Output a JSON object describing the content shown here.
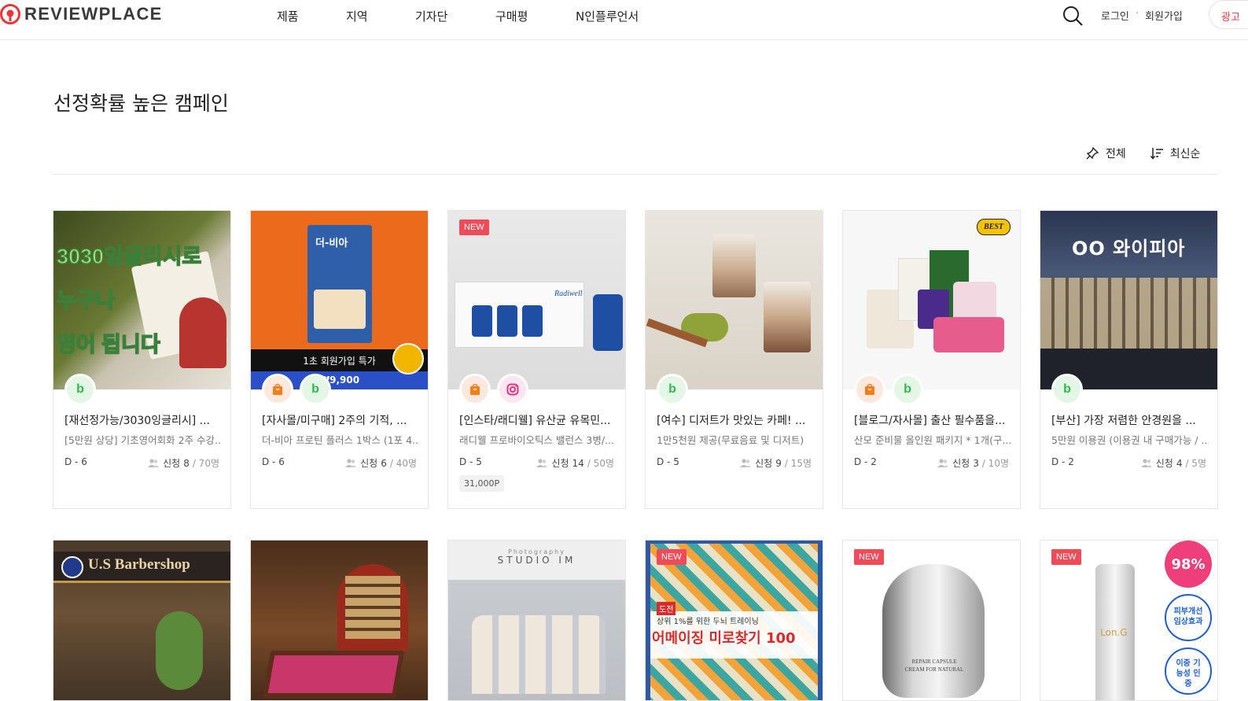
{
  "header": {
    "logo_text": "REVIEWPLACE",
    "nav": [
      "제품",
      "지역",
      "기자단",
      "구매평",
      "N인플루언서"
    ],
    "login": "로그인",
    "separator": "·",
    "signup": "회원가입",
    "ad": "광고"
  },
  "section": {
    "title": "선정확률 높은 캠페인",
    "filter_all": "전체",
    "sort_latest": "최신순"
  },
  "colors": {
    "accent": "#e8363c",
    "new_badge": "#ef4b58",
    "blog_green": "#2fb94a"
  },
  "cards": [
    {
      "title": "[재선정가능/3030잉글리시] ...",
      "subtitle": "[5만원 상당] 기초영어회화 2주 수강...",
      "dday": "D - 6",
      "apply_label": "신청",
      "applied": "8",
      "total": "/ 70명",
      "image_text": [
        "3030잉글리시로",
        "누구나",
        "영어 됩니다"
      ],
      "icons": [
        "blog"
      ]
    },
    {
      "title": "[자사몰/미구매] 2주의 기적, ...",
      "subtitle": "더-비아 프로틴 플러스 1박스 (1포 4...",
      "dday": "D - 6",
      "apply_label": "신청",
      "applied": "6",
      "total": "/ 40명",
      "image_text": [
        "더-비아",
        "1초 회원가입 특가",
        "₩9,900"
      ],
      "icons": [
        "shop",
        "blog"
      ]
    },
    {
      "title": "[인스타/래디웰] 유산균 유목민...",
      "subtitle": "래디웰 프로바이오틱스 밸런스 3병/...",
      "dday": "D - 5",
      "apply_label": "신청",
      "applied": "14",
      "total": "/ 50명",
      "point": "31,000P",
      "badge": "NEW",
      "image_text": [
        "Radiwell"
      ],
      "icons": [
        "shop",
        "insta"
      ]
    },
    {
      "title": "[여수] 디저트가 맛있는 카페! ...",
      "subtitle": "1만5천원 제공(무료음료 및 디저트)",
      "dday": "D - 5",
      "apply_label": "신청",
      "applied": "9",
      "total": "/ 15명",
      "icons": [
        "blog"
      ]
    },
    {
      "title": "[블로그/자사몰] 출산 필수품을...",
      "subtitle": "산모 준비물 올인원 패키지 * 1개(구...",
      "dday": "D - 2",
      "apply_label": "신청",
      "applied": "3",
      "total": "/ 10명",
      "badge": "BEST",
      "icons": [
        "shop",
        "blog"
      ]
    },
    {
      "title": "[부산] 가장 저렴한 안경원을 ...",
      "subtitle": "5만원 이용권 (이용권 내 구매가능 / ...",
      "dday": "D - 2",
      "apply_label": "신청",
      "applied": "4",
      "total": "/ 5명",
      "image_text": [
        "OO 와이피아"
      ],
      "icons": [
        "blog"
      ]
    }
  ],
  "cards_row2": [
    {
      "image_text": [
        "U.S Barbershop"
      ]
    },
    {
      "image_text": []
    },
    {
      "image_text": [
        "Photography",
        "STUDIO IM"
      ]
    },
    {
      "badge": "NEW",
      "image_text": [
        "상위 1%를 위한 두뇌 트레이닝",
        "어메이징 미로찾기 100",
        "도전"
      ]
    },
    {
      "badge": "NEW",
      "image_text": [
        "REPAIR CAPSULE",
        "CREAM FOR NATURAL"
      ]
    },
    {
      "badge": "NEW",
      "image_text": [
        "98%",
        "피부개선 임상효과",
        "이중 기능성 인증",
        "Lon.G"
      ]
    }
  ]
}
